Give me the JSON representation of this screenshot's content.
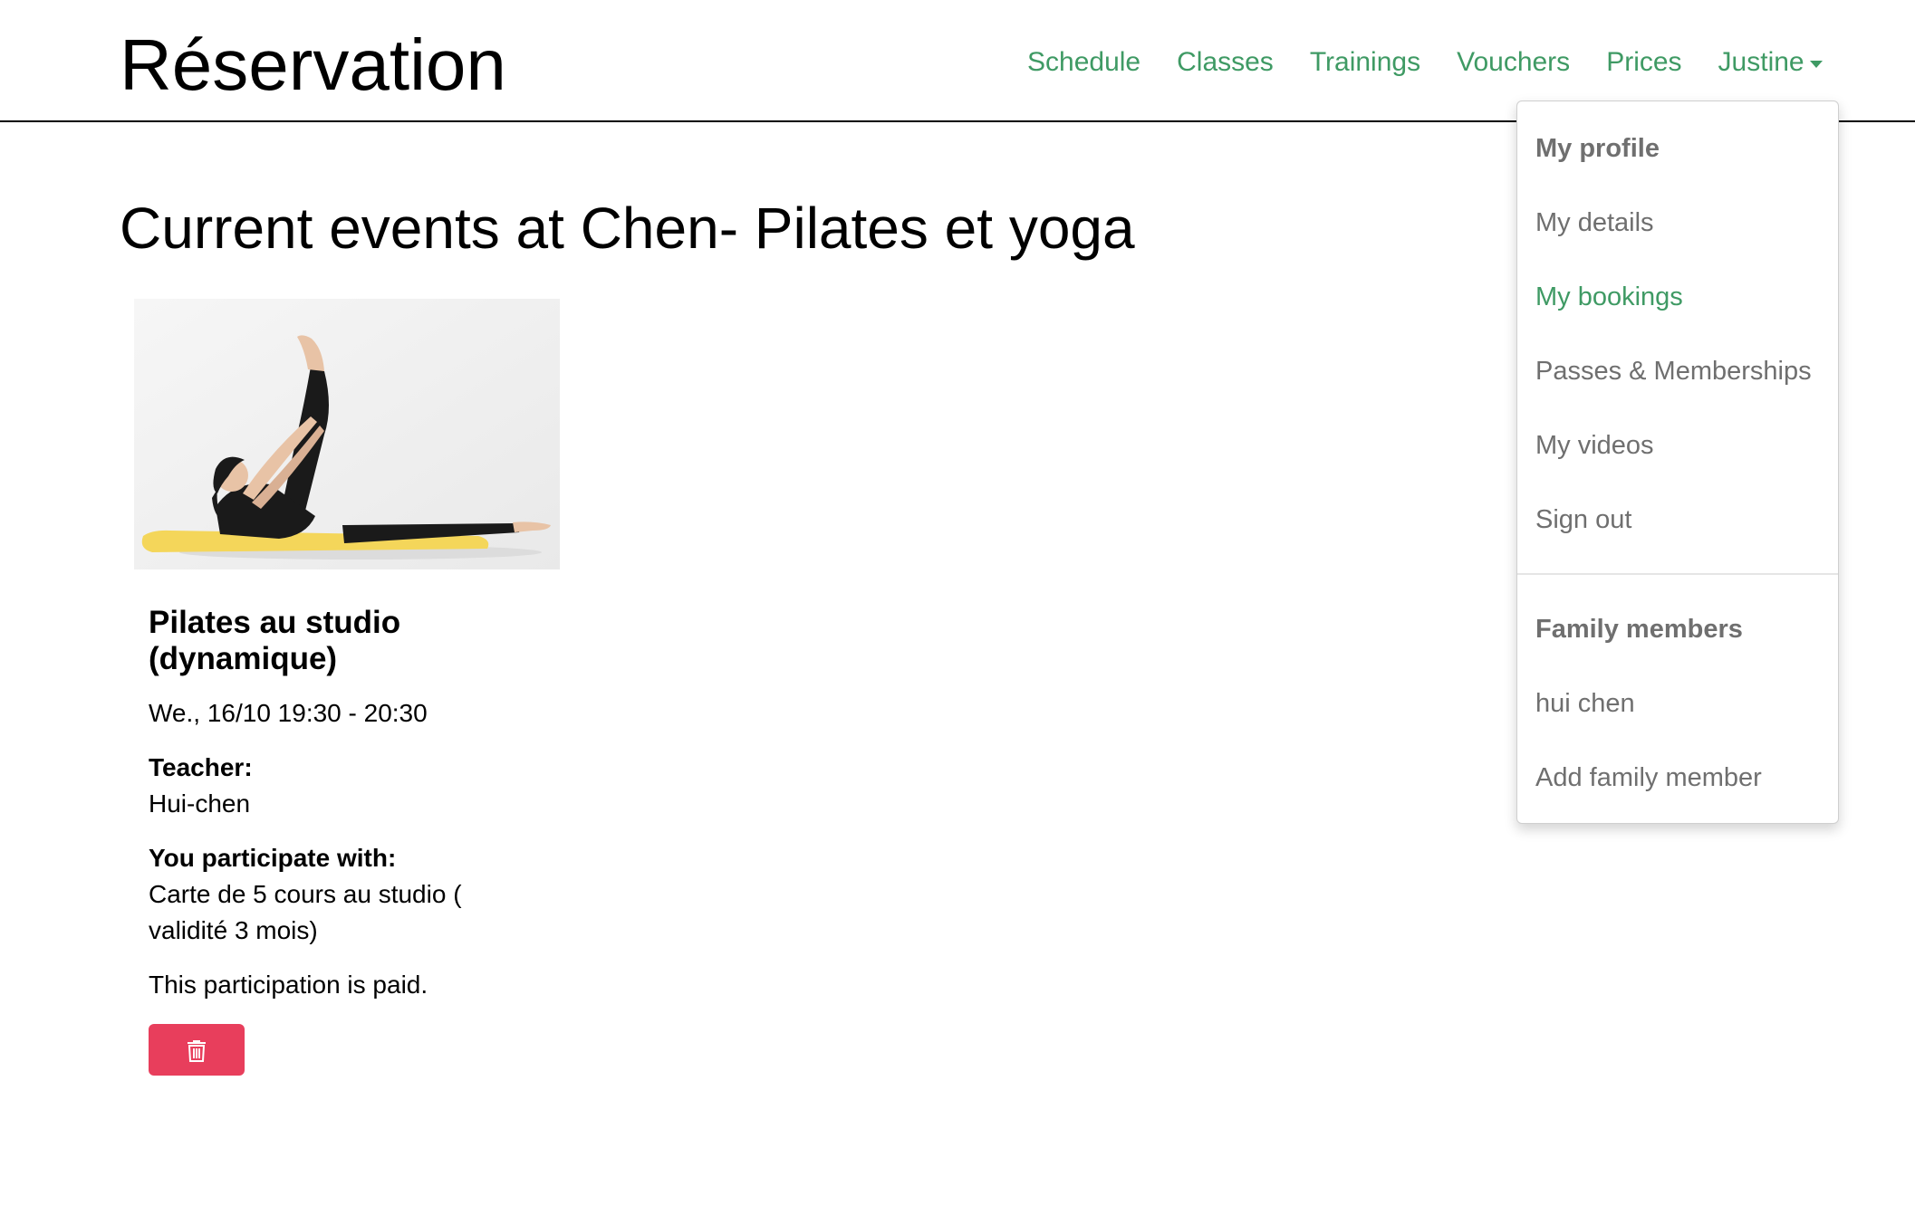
{
  "header": {
    "brand": "Réservation",
    "nav": {
      "schedule": "Schedule",
      "classes": "Classes",
      "trainings": "Trainings",
      "vouchers": "Vouchers",
      "prices": "Prices",
      "user": "Justine"
    }
  },
  "main": {
    "title": "Current events at Chen- Pilates et yoga",
    "event": {
      "title": "Pilates au studio (dynamique)",
      "datetime": "We., 16/10 19:30 - 20:30",
      "teacher_label": "Teacher:",
      "teacher": "Hui-chen",
      "participate_label": "You participate with:",
      "participate_value": "Carte de 5 cours au studio ( validité 3 mois)",
      "payment_status": "This participation is paid."
    }
  },
  "dropdown": {
    "profile_header": "My profile",
    "my_details": "My details",
    "my_bookings": "My bookings",
    "passes": "Passes & Memberships",
    "my_videos": "My videos",
    "sign_out": "Sign out",
    "family_header": "Family members",
    "family_member": "hui chen",
    "add_family": "Add family member"
  },
  "colors": {
    "nav_link": "#3f9a64",
    "active_menu": "#3f9a64",
    "menu_text": "#6f6f6f",
    "delete_button": "#e83e5c",
    "mat": "#f4d65a"
  },
  "icons": {
    "delete": "trash-icon",
    "user_menu": "caret-down-icon"
  }
}
